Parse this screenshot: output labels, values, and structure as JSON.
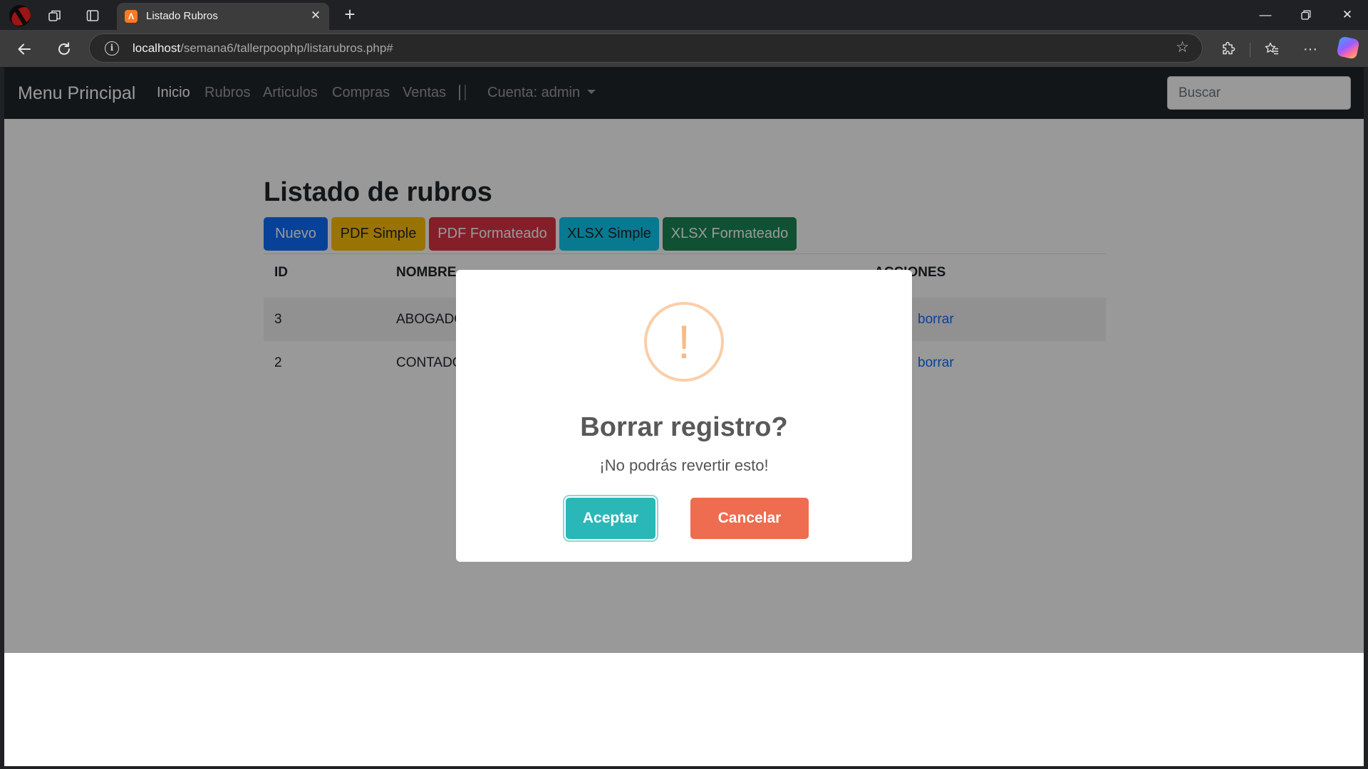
{
  "browser": {
    "tab_title": "Listado Rubros",
    "tab_favicon_glyph": "Ʌ",
    "url_host": "localhost",
    "url_path": "/semana6/tallerpoophp/listarubros.php#",
    "icons": [
      "profile-avatar-icon",
      "workspaces-icon",
      "tab-actions-icon",
      "close-icon",
      "plus-icon",
      "minimize-icon",
      "restore-icon",
      "back-icon",
      "refresh-icon",
      "site-info-icon",
      "favorite-star-icon",
      "extensions-icon",
      "favorites-icon",
      "more-icon",
      "copilot-icon"
    ]
  },
  "navbar": {
    "brand": "Menu Principal",
    "links": [
      "Inicio",
      "Rubros",
      "Articulos",
      "Compras",
      "Ventas"
    ],
    "account": "Cuenta: admin",
    "search_placeholder": "Buscar"
  },
  "page": {
    "title": "Listado de rubros",
    "buttons": [
      {
        "label": "Nuevo",
        "color": "#0d6efd"
      },
      {
        "label": "PDF Simple",
        "color": "#ffc107"
      },
      {
        "label": "PDF Formateado",
        "color": "#dc3545"
      },
      {
        "label": "XLSX Simple",
        "color": "#0dcaf0"
      },
      {
        "label": "XLSX Formateado",
        "color": "#198754"
      }
    ],
    "table": {
      "headers": [
        "ID",
        "NOMBRE",
        "ACCIONES"
      ],
      "rows": [
        {
          "id": "3",
          "nombre": "ABOGADO",
          "accion": "borrar"
        },
        {
          "id": "2",
          "nombre": "CONTADOR",
          "accion": "borrar"
        }
      ]
    }
  },
  "modal": {
    "icon": "warning-icon",
    "icon_glyph": "!",
    "title": "Borrar registro?",
    "text": "¡No podrás revertir esto!",
    "confirm_label": "Aceptar",
    "cancel_label": "Cancelar",
    "colors": {
      "confirm": "#2ab7b7",
      "cancel": "#ee6c4f",
      "warning": "#f8bb86"
    }
  }
}
